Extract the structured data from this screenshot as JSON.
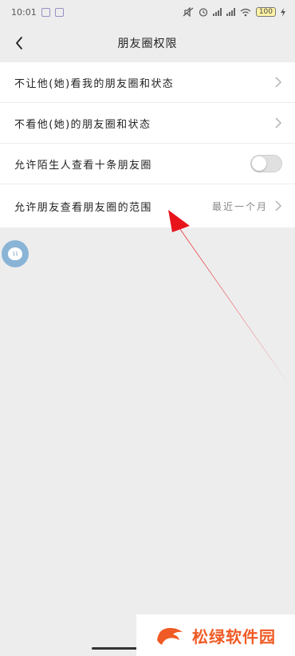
{
  "status_bar": {
    "time": "10:01",
    "battery": "100"
  },
  "nav": {
    "title": "朋友圈权限"
  },
  "settings": {
    "rows": [
      {
        "label": "不让他(她)看我的朋友圈和状态"
      },
      {
        "label": "不看他(她)的朋友圈和状态"
      },
      {
        "label": "允许陌生人查看十条朋友圈",
        "toggle_on": false
      },
      {
        "label": "允许朋友查看朋友圈的范围",
        "value": "最近一个月"
      }
    ]
  },
  "bubble": {
    "text": "11"
  },
  "watermark": {
    "text": "松绿软件园"
  },
  "colors": {
    "background": "#ededed",
    "annotation_arrow": "#e8141c",
    "watermark": "#f05a24"
  }
}
